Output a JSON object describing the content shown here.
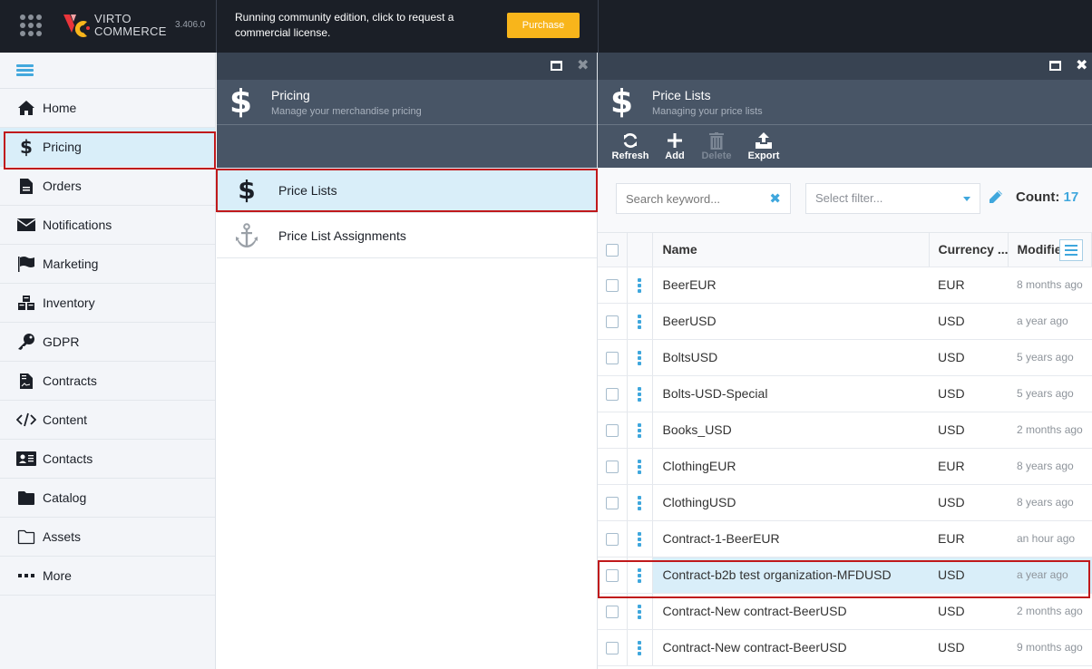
{
  "topbar": {
    "brand_line1": "VIRTO",
    "brand_line2": "COMMERCE",
    "version": "3.406.0",
    "notice_line1": "Running community edition, click to request a",
    "notice_line2": "commercial license.",
    "purchase_label": "Purchase",
    "accent": "#f8b51b"
  },
  "sidebar": {
    "items": [
      {
        "label": "Home",
        "icon": "home-icon"
      },
      {
        "label": "Pricing",
        "icon": "dollar-icon",
        "active": true
      },
      {
        "label": "Orders",
        "icon": "document-icon"
      },
      {
        "label": "Notifications",
        "icon": "envelope-icon"
      },
      {
        "label": "Marketing",
        "icon": "flag-icon"
      },
      {
        "label": "Inventory",
        "icon": "cubes-icon"
      },
      {
        "label": "GDPR",
        "icon": "key-icon"
      },
      {
        "label": "Contracts",
        "icon": "contract-icon"
      },
      {
        "label": "Content",
        "icon": "code-icon"
      },
      {
        "label": "Contacts",
        "icon": "id-card-icon"
      },
      {
        "label": "Catalog",
        "icon": "folder-icon"
      },
      {
        "label": "Assets",
        "icon": "folder-outline-icon"
      },
      {
        "label": "More",
        "icon": "more-icon"
      }
    ]
  },
  "pricing_blade": {
    "title": "Pricing",
    "subtitle": "Manage your merchandise pricing",
    "items": [
      {
        "label": "Price Lists",
        "icon": "dollar-icon",
        "active": true
      },
      {
        "label": "Price List Assignments",
        "icon": "anchor-icon"
      }
    ]
  },
  "pricelists_blade": {
    "title": "Price Lists",
    "subtitle": "Managing your price lists",
    "toolbar": {
      "refresh": "Refresh",
      "add": "Add",
      "delete": "Delete",
      "export": "Export"
    },
    "search_placeholder": "Search keyword...",
    "filter_placeholder": "Select filter...",
    "count_label": "Count:",
    "count_value": "17",
    "columns": {
      "name": "Name",
      "currency": "Currency ...",
      "modified": "Modifie"
    },
    "rows": [
      {
        "name": "BeerEUR",
        "currency": "EUR",
        "modified": "8 months ago"
      },
      {
        "name": "BeerUSD",
        "currency": "USD",
        "modified": "a year ago"
      },
      {
        "name": "BoltsUSD",
        "currency": "USD",
        "modified": "5 years ago"
      },
      {
        "name": "Bolts-USD-Special",
        "currency": "USD",
        "modified": "5 years ago"
      },
      {
        "name": "Books_USD",
        "currency": "USD",
        "modified": "2 months ago"
      },
      {
        "name": "ClothingEUR",
        "currency": "EUR",
        "modified": "8 years ago"
      },
      {
        "name": "ClothingUSD",
        "currency": "USD",
        "modified": "8 years ago"
      },
      {
        "name": "Contract-1-BeerEUR",
        "currency": "EUR",
        "modified": "an hour ago"
      },
      {
        "name": "Contract-b2b test organization-MFDUSD",
        "currency": "USD",
        "modified": "a year ago",
        "selected": true
      },
      {
        "name": "Contract-New contract-BeerUSD",
        "currency": "USD",
        "modified": "2 months ago"
      },
      {
        "name": "Contract-New contract-BeerUSD",
        "currency": "USD",
        "modified": "9 months ago"
      }
    ]
  }
}
